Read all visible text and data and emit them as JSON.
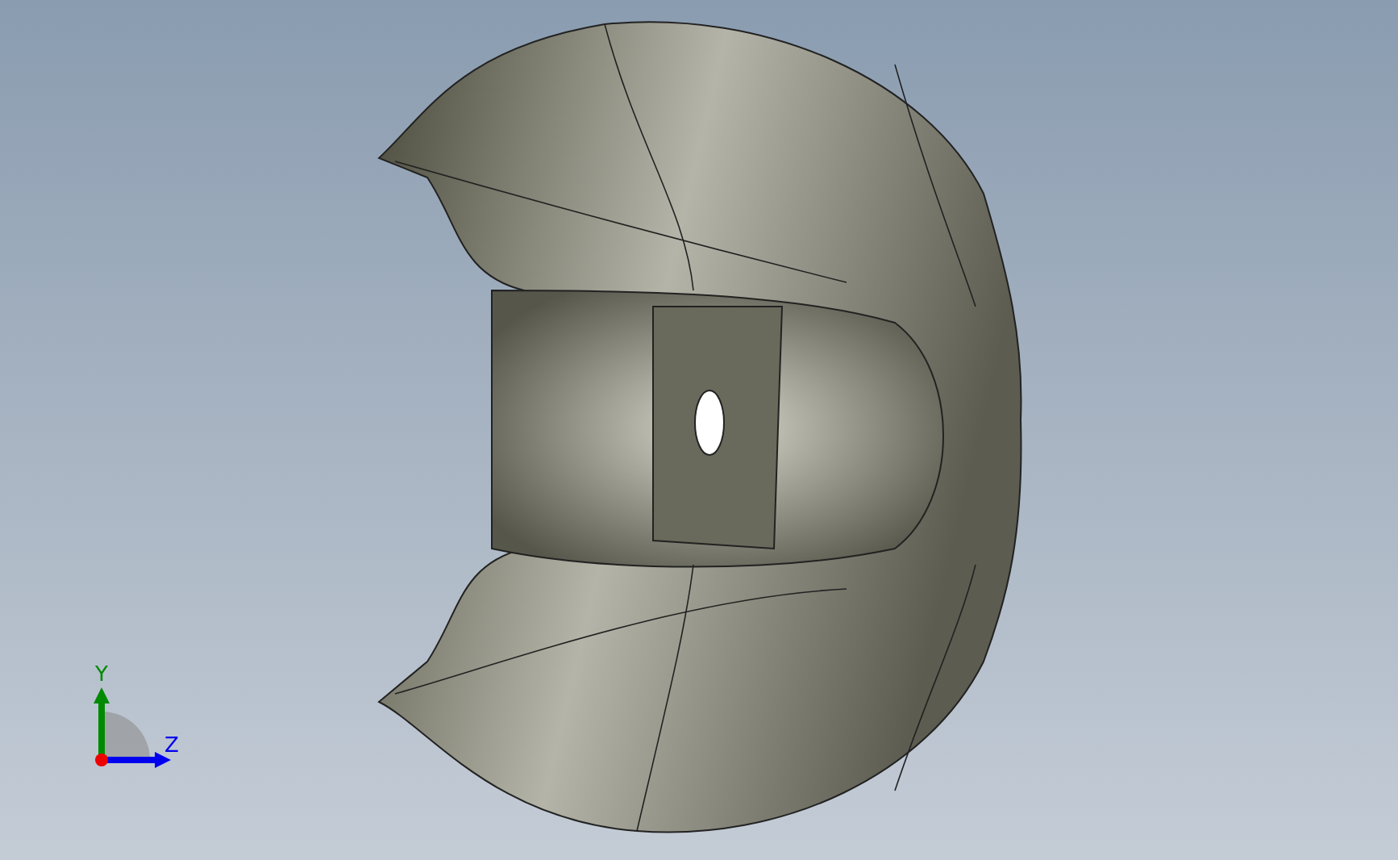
{
  "viewport": {
    "triad": {
      "axes": [
        {
          "label": "Y",
          "color": "#008a00"
        },
        {
          "label": "Z",
          "color": "#0000ee"
        }
      ]
    }
  }
}
